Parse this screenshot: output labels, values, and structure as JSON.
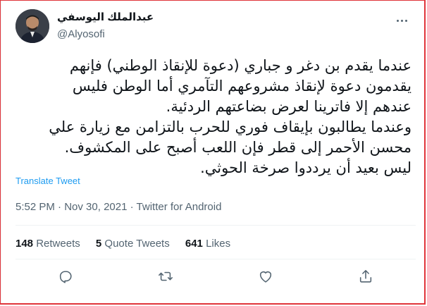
{
  "user": {
    "display_name": "عبدالملك اليوسفي",
    "handle": "@Alyosofi"
  },
  "tweet": {
    "lines": [
      "عندما يقدم بن دغر و جباري (دعوة للإنقاذ الوطني) فإنهم",
      "يقدمون دعوة لإنقاذ مشروعهم التآمري أما الوطن فليس",
      "عندهم إلا فاترينا لعرض بضاعتهم الردئية.",
      "وعندما يطالبون بإيقاف فوري للحرب بالتزامن مع زيارة علي",
      "محسن الأحمر إلى قطر فإن اللعب أصبح على المكشوف.",
      "ليس بعيد أن يرددوا صرخة الحوثي."
    ],
    "translate_label": "Translate Tweet",
    "time": "5:52 PM",
    "separator": "·",
    "date": "Nov 30, 2021",
    "source": "Twitter for Android"
  },
  "stats": {
    "retweets_count": "148",
    "retweets_label": "Retweets",
    "quotes_count": "5",
    "quotes_label": "Quote Tweets",
    "likes_count": "641",
    "likes_label": "Likes"
  },
  "actions": [
    "reply-icon",
    "retweet-icon",
    "like-icon",
    "share-icon"
  ],
  "colors": {
    "link": "#1d9bf0",
    "secondary_text": "#536471",
    "primary_text": "#0f1419",
    "frame": "#e0343a"
  }
}
